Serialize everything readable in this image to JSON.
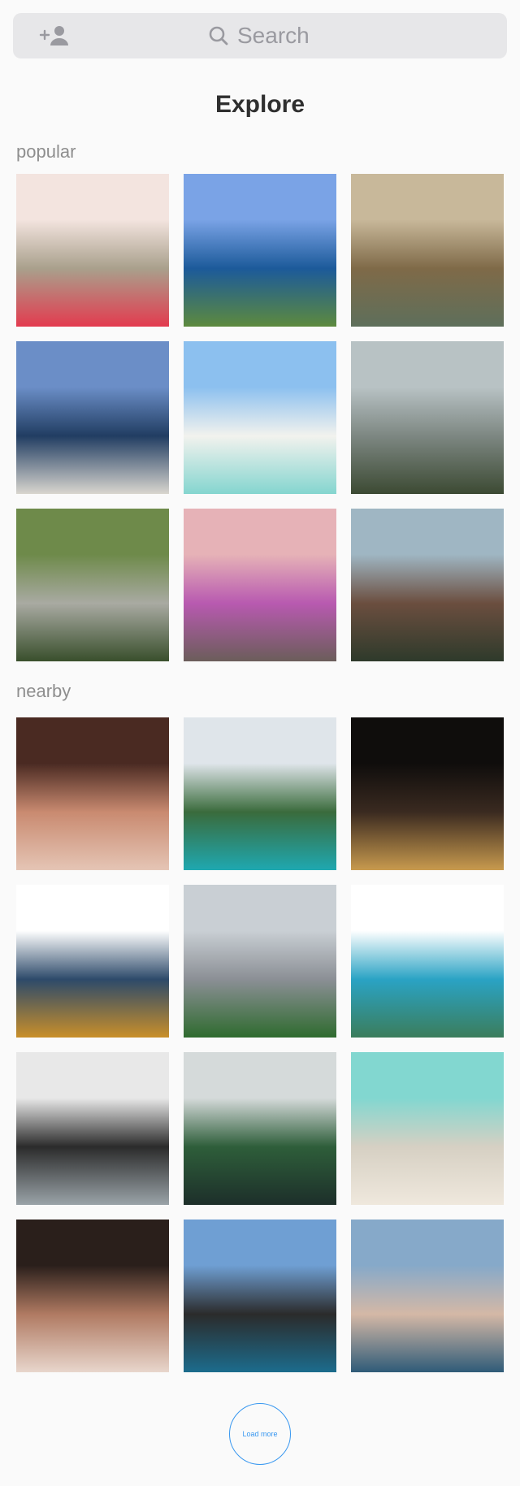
{
  "header": {
    "add_user_icon": "add-user-icon",
    "search_icon": "search-icon",
    "search_label": "Search"
  },
  "page": {
    "title": "Explore"
  },
  "popular": {
    "label": "popular",
    "photos": [
      {
        "id": "venice-gondola",
        "colors": [
          "#f3e4df",
          "#a9a08c",
          "#e33b4f"
        ]
      },
      {
        "id": "sydney-harbour",
        "colors": [
          "#7aa3e6",
          "#1c5a9a",
          "#5d8a3e"
        ]
      },
      {
        "id": "venice-alley",
        "colors": [
          "#c8b89a",
          "#7f6a48",
          "#5e6f5b"
        ]
      },
      {
        "id": "lake-sitting",
        "colors": [
          "#6b8ec7",
          "#213d62",
          "#d9d6cf"
        ]
      },
      {
        "id": "pool-pink-swimsuit",
        "colors": [
          "#8cc0ef",
          "#f2f2ee",
          "#84d5cf"
        ]
      },
      {
        "id": "foggy-castle",
        "colors": [
          "#b8c2c4",
          "#7d8782",
          "#3c4a33"
        ]
      },
      {
        "id": "serpentine-road",
        "colors": [
          "#6e8a4a",
          "#a9aaa2",
          "#394f2c"
        ]
      },
      {
        "id": "pink-house-flowers",
        "colors": [
          "#e6b2b7",
          "#b85ab0",
          "#6b5d5a"
        ]
      },
      {
        "id": "plaza-palms",
        "colors": [
          "#9fb6c3",
          "#6b4e3f",
          "#2e3a2b"
        ]
      }
    ]
  },
  "nearby": {
    "label": "nearby",
    "photos": [
      {
        "id": "ice-cream-girls",
        "colors": [
          "#4a2a22",
          "#c98a70",
          "#e5c5b5"
        ]
      },
      {
        "id": "lake-village-pier",
        "colors": [
          "#dfe5ea",
          "#3a6b3c",
          "#1fa8b0"
        ]
      },
      {
        "id": "night-hot-tub",
        "colors": [
          "#0f0d0c",
          "#3a2a20",
          "#c89a4e"
        ]
      },
      {
        "id": "beach-sunset",
        "colors": [
          "#ffffff",
          "#2d4a6a",
          "#c98f2a"
        ]
      },
      {
        "id": "bikini-palm",
        "colors": [
          "#c9cfd4",
          "#8b8f95",
          "#2f6b2f"
        ]
      },
      {
        "id": "island-panorama",
        "colors": [
          "#ffffff",
          "#2aa3c4",
          "#3b7d5c"
        ]
      },
      {
        "id": "white-villa",
        "colors": [
          "#e8e8e8",
          "#2b2b2b",
          "#9aa3a8"
        ]
      },
      {
        "id": "lake-chapel",
        "colors": [
          "#d5dada",
          "#2e5e3a",
          "#1d2f2a"
        ]
      },
      {
        "id": "clear-water-sand",
        "colors": [
          "#82d7d0",
          "#d6d0c3",
          "#efe8dd"
        ]
      },
      {
        "id": "wine-portrait",
        "colors": [
          "#2a1f1b",
          "#b07a62",
          "#e8d6cc"
        ]
      },
      {
        "id": "volcanic-coast",
        "colors": [
          "#6f9fd3",
          "#2b2b2b",
          "#1c6c8d"
        ]
      },
      {
        "id": "harbor-houses",
        "colors": [
          "#86a9c9",
          "#d4b8a6",
          "#2f5b78"
        ]
      }
    ]
  },
  "load_more": {
    "label": "Load more"
  }
}
